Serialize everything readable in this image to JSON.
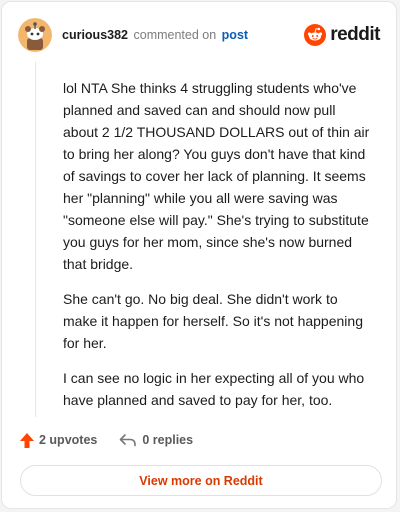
{
  "header": {
    "username": "curious382",
    "commented_text": "commented on",
    "post_link": "post",
    "brand": "reddit"
  },
  "comment": {
    "paragraphs": [
      "lol NTA She thinks 4 struggling students who've planned and saved can and should now pull about 2 1/2 THOUSAND DOLLARS out of thin air to bring her along? You guys don't have that kind of savings to cover her lack of planning. It seems her \"planning\" while you all were saving was \"someone else will pay.\" She's trying to substitute you guys for her mom, since she's now burned that bridge.",
      "She can't go. No big deal. She didn't work to make it happen for herself. So it's not happening for her.",
      "I can see no logic in her expecting all of you who have planned and saved to pay for her, too."
    ]
  },
  "actions": {
    "upvotes": "2 upvotes",
    "replies": "0 replies"
  },
  "footer": {
    "view_more": "View more on Reddit"
  },
  "colors": {
    "brand_orange": "#ff4500",
    "link_blue": "#0a5fb3",
    "button_text": "#d93a00",
    "avatar_bg": "#f2b66d"
  },
  "icons": {
    "avatar": "snoo-avatar-icon",
    "brand": "reddit-logo-icon",
    "upvote": "upvote-arrow-icon",
    "reply": "reply-arrow-icon"
  }
}
